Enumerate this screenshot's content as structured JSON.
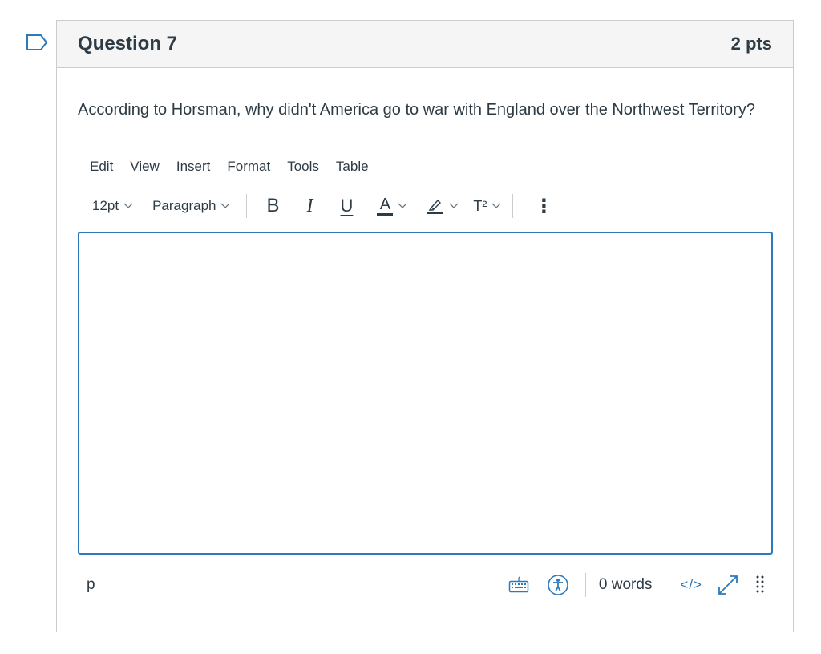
{
  "question": {
    "title": "Question 7",
    "points": "2 pts",
    "text": "According to Horsman, why didn't America go to war with England over the Northwest Territory?"
  },
  "editor": {
    "menu": [
      "Edit",
      "View",
      "Insert",
      "Format",
      "Tools",
      "Table"
    ],
    "toolbar": {
      "font_size": "12pt",
      "block_format": "Paragraph",
      "bold_label": "B",
      "italic_label": "I",
      "underline_label": "U",
      "text_color_label": "A",
      "superscript_label": "T²",
      "more_label": "⋮",
      "text_color": "#2d3b45",
      "highlight_color": "#2d3b45"
    },
    "content": "",
    "statusbar": {
      "path": "p",
      "word_count": "0 words",
      "html_toggle": "</>"
    },
    "accent_color": "#2b7abc"
  }
}
